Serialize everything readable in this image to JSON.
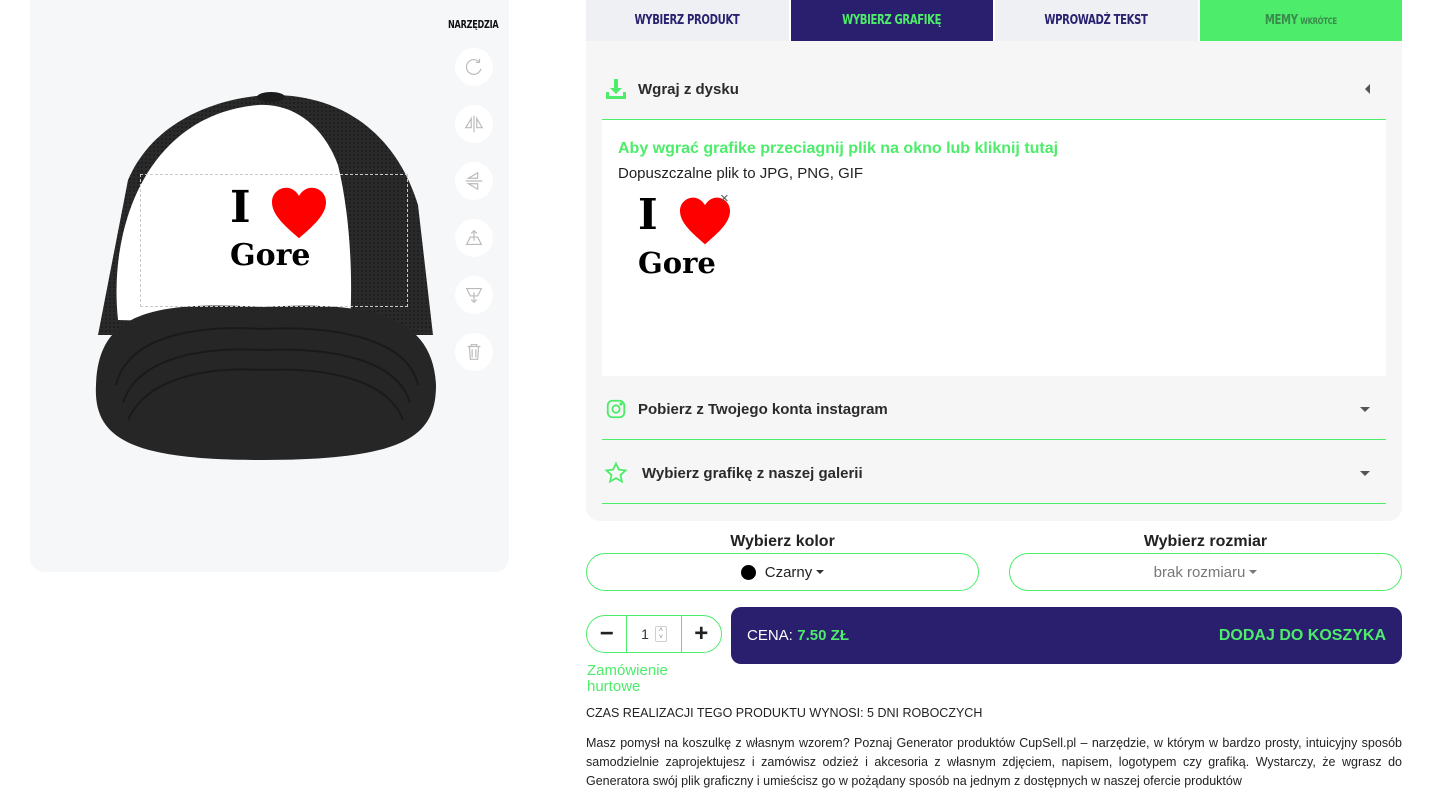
{
  "tools": {
    "label": "NARZĘDZIA",
    "items": [
      "rotate-icon",
      "flip-horizontal-icon",
      "flip-vertical-icon",
      "bring-forward-icon",
      "send-backward-icon",
      "trash-icon"
    ]
  },
  "design": {
    "line1": "I",
    "line2": "Gore",
    "heart_color": "#ff0000"
  },
  "tabs": {
    "product": "WYBIERZ PRODUKT",
    "graphic": "WYBIERZ GRAFIKĘ",
    "text": "WPROWADŹ TEKST",
    "memes": "MEMY",
    "memes_soon": "WKRÓTCE"
  },
  "upload": {
    "title": "Wgraj z dysku",
    "dropzone_title": "Aby wgrać grafike przeciagnij plik na okno lub kliknij tutaj",
    "dropzone_sub": "Dopuszczalne plik to JPG, PNG, GIF",
    "remove": "×"
  },
  "instagram": {
    "title": "Pobierz z Twojego konta instagram"
  },
  "gallery": {
    "title": "Wybierz grafikę z naszej galerii"
  },
  "color": {
    "label": "Wybierz kolor",
    "selected": "Czarny",
    "swatch": "#000000"
  },
  "size": {
    "label": "Wybierz rozmiar",
    "selected": "brak rozmiaru"
  },
  "quantity": {
    "minus": "−",
    "value": "1",
    "plus": "+"
  },
  "wholesale": "Zamówienie hurtowe",
  "cart": {
    "price_label": "CENA:",
    "price": "7.50 ZŁ",
    "add": "DODAJ DO KOSZYKA"
  },
  "realization": "CZAS REALIZACJI TEGO PRODUKTU WYNOSI: 5 DNI ROBOCZYCH",
  "description": "Masz pomysł na koszulkę z własnym wzorem? Poznaj Generator produktów CupSell.pl – narzędzie, w którym w bardzo prosty, intuicyjny sposób samodzielnie zaprojektujesz i zamówisz odzież i akcesoria z własnym zdjęciem, napisem, logotypem czy grafiką. Wystarczy, że wgrasz do Generatora swój plik graficzny i umieścisz go w pożądany sposób na jednym z dostępnych w naszej ofercie produktów",
  "colors": {
    "green": "#4dec6a",
    "navy": "#2a1f6e",
    "panel": "#f6f6f6"
  }
}
